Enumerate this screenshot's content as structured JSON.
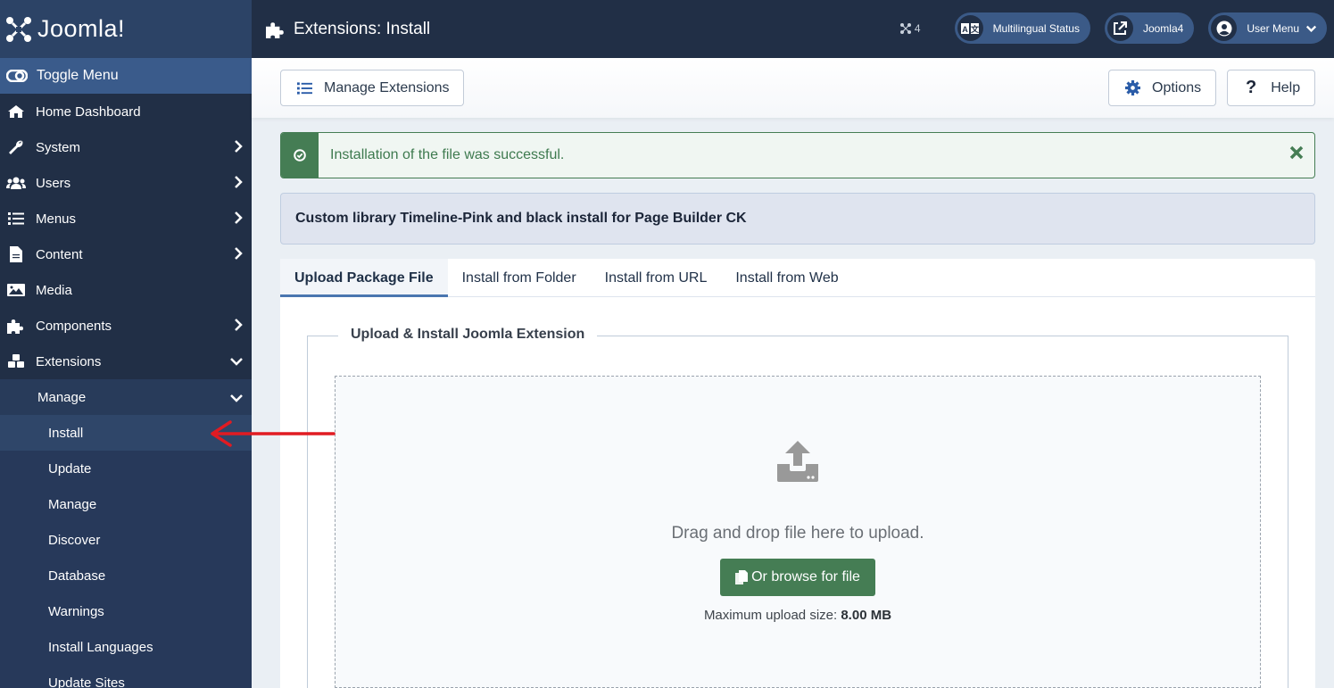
{
  "brand": {
    "name": "Joomla!"
  },
  "header": {
    "title": "Extensions: Install",
    "counter": "4",
    "pills": [
      {
        "label": "Multilingual Status",
        "icon": "language-icon"
      },
      {
        "label": "Joomla4",
        "icon": "external-link-icon"
      },
      {
        "label": "User Menu",
        "icon": "user-circle-icon"
      }
    ]
  },
  "sidebar": {
    "toggle_label": "Toggle Menu",
    "items": [
      {
        "label": "Home Dashboard",
        "icon": "home-icon",
        "has_children": false
      },
      {
        "label": "System",
        "icon": "wrench-icon",
        "has_children": true
      },
      {
        "label": "Users",
        "icon": "users-icon",
        "has_children": true
      },
      {
        "label": "Menus",
        "icon": "list-icon",
        "has_children": true
      },
      {
        "label": "Content",
        "icon": "file-icon",
        "has_children": true
      },
      {
        "label": "Media",
        "icon": "image-icon",
        "has_children": false
      },
      {
        "label": "Components",
        "icon": "puzzle-icon",
        "has_children": true
      },
      {
        "label": "Extensions",
        "icon": "cubes-icon",
        "has_children": true,
        "expanded": true
      }
    ],
    "submenu": {
      "header": "Manage",
      "items": [
        {
          "label": "Install",
          "active": true
        },
        {
          "label": "Update"
        },
        {
          "label": "Manage"
        },
        {
          "label": "Discover"
        },
        {
          "label": "Database"
        },
        {
          "label": "Warnings"
        },
        {
          "label": "Install Languages"
        },
        {
          "label": "Update Sites"
        }
      ]
    }
  },
  "toolbar": {
    "manage_label": "Manage Extensions",
    "options_label": "Options",
    "help_label": "Help"
  },
  "alert": {
    "message": "Installation of the file was successful.",
    "color": "#457d54"
  },
  "info": {
    "message": "Custom library Timeline-Pink and black install for Page Builder CK"
  },
  "tabs": [
    {
      "label": "Upload Package File",
      "active": true
    },
    {
      "label": "Install from Folder"
    },
    {
      "label": "Install from URL"
    },
    {
      "label": "Install from Web"
    }
  ],
  "upload": {
    "legend": "Upload & Install Joomla Extension",
    "drop_text": "Drag and drop file here to upload.",
    "browse_label": "Or browse for file",
    "max_label": "Maximum upload size:",
    "max_value": "8.00 MB"
  },
  "colors": {
    "sidebar_bg": "#212f46",
    "accent": "#3a5b8b",
    "success": "#457d54",
    "annotation_arrow": "#e11b22"
  }
}
